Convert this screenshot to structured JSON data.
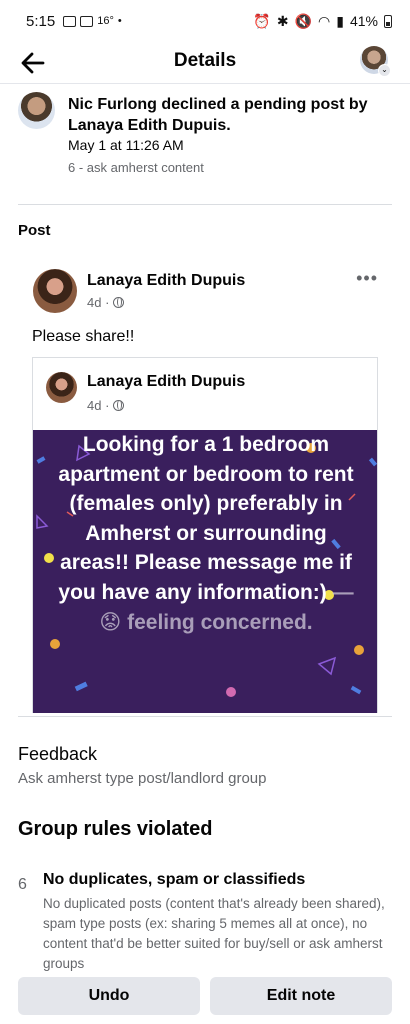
{
  "status_bar": {
    "time": "5:15",
    "temperature": "16°",
    "battery": "41%"
  },
  "app_bar": {
    "title": "Details"
  },
  "activity": {
    "text": "Nic Furlong declined a pending post by Lanaya Edith Dupuis.",
    "timestamp": "May 1 at 11:26 AM",
    "subtext": "6 - ask amherst content"
  },
  "post_section": {
    "label": "Post",
    "author": "Lanaya Edith Dupuis",
    "age": "4d ·",
    "text": "Please share!!",
    "shared": {
      "author": "Lanaya Edith Dupuis",
      "age": "4d ·",
      "banner_text": "Looking for a 1 bedroom apartment or bedroom to rent (females only) preferably in Amherst or surrounding areas!! Please message me if you have any information:)",
      "feeling": "— 😟 feeling concerned.",
      "banner_color": "#3a1f5d"
    }
  },
  "feedback": {
    "label": "Feedback",
    "value": "Ask amherst type post/landlord group"
  },
  "rules": {
    "title": "Group rules violated",
    "items": [
      {
        "number": "6",
        "title": "No duplicates, spam or classifieds",
        "description": "No duplicated posts (content that's already been shared), spam type posts (ex: sharing 5 memes all at once), no content that'd be better suited for buy/sell or ask amherst groups"
      }
    ]
  },
  "buttons": {
    "undo": "Undo",
    "edit_note": "Edit note"
  }
}
